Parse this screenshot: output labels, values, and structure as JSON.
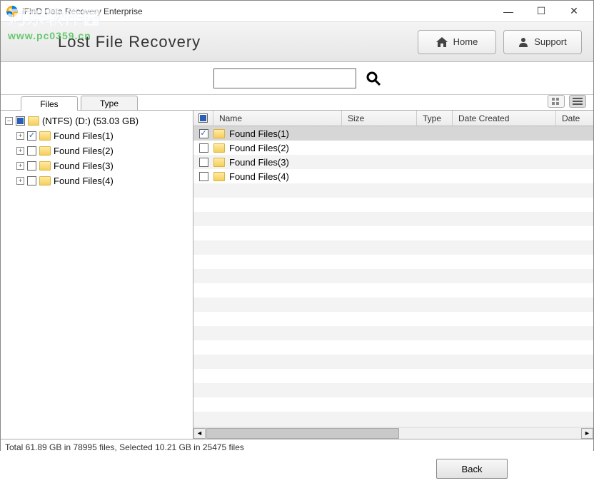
{
  "window": {
    "title": "iFinD Data Recovery Enterprise"
  },
  "header": {
    "page_title": "Lost File Recovery",
    "home_label": "Home",
    "support_label": "Support"
  },
  "search": {
    "placeholder": ""
  },
  "tabs": {
    "files": "Files",
    "type": "Type"
  },
  "tree": {
    "root": "(NTFS) (D:) (53.03 GB)",
    "items": [
      {
        "label": "Found Files(1)",
        "checked": true
      },
      {
        "label": "Found Files(2)",
        "checked": false
      },
      {
        "label": "Found Files(3)",
        "checked": false
      },
      {
        "label": "Found Files(4)",
        "checked": false
      }
    ]
  },
  "columns": {
    "name": "Name",
    "size": "Size",
    "type": "Type",
    "created": "Date Created",
    "date2": "Date"
  },
  "rows": [
    {
      "name": "Found Files(1)",
      "checked": true,
      "selected": true
    },
    {
      "name": "Found Files(2)",
      "checked": false,
      "selected": false
    },
    {
      "name": "Found Files(3)",
      "checked": false,
      "selected": false
    },
    {
      "name": "Found Files(4)",
      "checked": false,
      "selected": false
    }
  ],
  "status": "Total 61.89 GB in 78995 files,  Selected 10.21 GB in 25475 files",
  "footer": {
    "back": "Back"
  },
  "watermark": {
    "cn": "河东软件园",
    "url": "www.pc0359.cn"
  }
}
